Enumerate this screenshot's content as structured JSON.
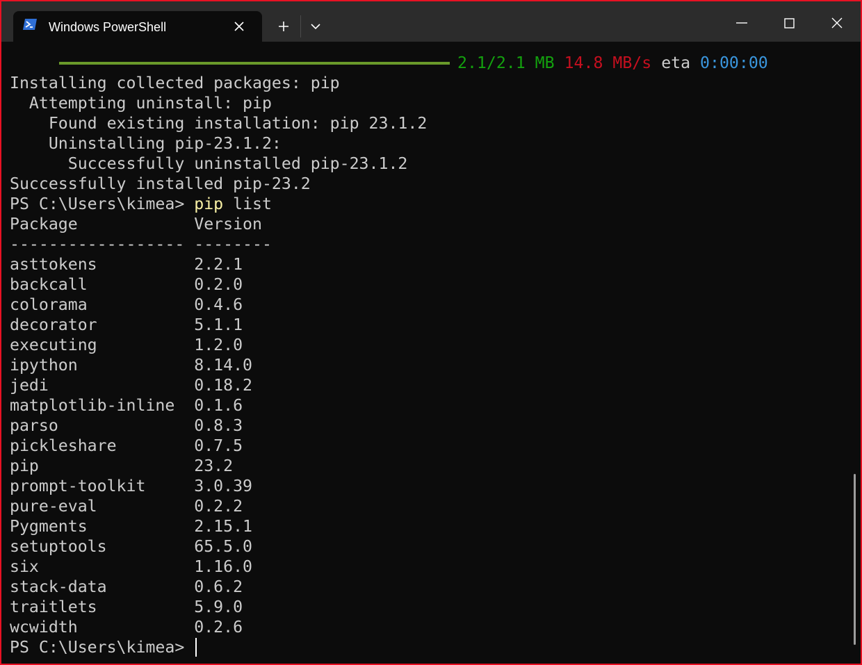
{
  "window": {
    "tab_title": "Windows PowerShell",
    "new_tab_label": "+",
    "colors": {
      "border": "#e81123",
      "titlebar": "#2c2c2c",
      "terminal_bg": "#0c0c0c",
      "text": "#cccccc"
    }
  },
  "progress": {
    "fraction": 1.0,
    "size": "2.1/2.1 MB",
    "speed": "14.8 MB/s",
    "eta_label": "eta",
    "eta": "0:00:00"
  },
  "output": {
    "install_lines": [
      "Installing collected packages: pip",
      "  Attempting uninstall: pip",
      "    Found existing installation: pip 23.1.2",
      "    Uninstalling pip-23.1.2:",
      "      Successfully uninstalled pip-23.1.2",
      "Successfully installed pip-23.2"
    ],
    "prompt": "PS C:\\Users\\kimea>",
    "command_name": "pip",
    "command_args": "list",
    "header": "Package            Version",
    "separator": "------------------ --------",
    "packages": [
      "asttokens          2.2.1",
      "backcall           0.2.0",
      "colorama           0.4.6",
      "decorator          5.1.1",
      "executing          1.2.0",
      "ipython            8.14.0",
      "jedi               0.18.2",
      "matplotlib-inline  0.1.6",
      "parso              0.8.3",
      "pickleshare        0.7.5",
      "pip                23.2",
      "prompt-toolkit     3.0.39",
      "pure-eval          0.2.2",
      "Pygments           2.15.1",
      "setuptools         65.5.0",
      "six                1.16.0",
      "stack-data         0.6.2",
      "traitlets          5.9.0",
      "wcwidth            0.2.6"
    ]
  }
}
